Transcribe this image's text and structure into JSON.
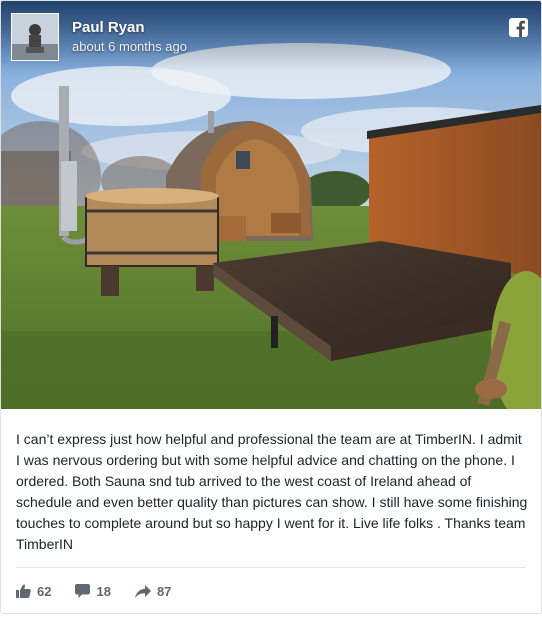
{
  "post": {
    "author": "Paul Ryan",
    "timestamp": "about 6 months ago",
    "text": "I can’t express just how helpful and professional the team are at TimberIN. I admit I was nervous ordering but with some helpful advice and chatting on the phone. I ordered. Both Sauna snd tub arrived to the west coast of Ireland ahead of schedule and even better quality than pictures can show. I still have some finishing touches to complete around but so happy I went for it. Live life folks . Thanks team TimberIN",
    "source_icon": "facebook-icon",
    "photo_icon": "sauna-and-hot-tub-photo"
  },
  "stats": {
    "likes": "62",
    "comments": "18",
    "shares": "87"
  },
  "colors": {
    "text": "#1d2129",
    "stat_gray": "#616770",
    "border": "#dddfe2"
  }
}
